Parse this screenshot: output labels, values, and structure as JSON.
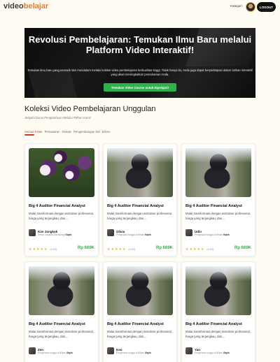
{
  "header": {
    "logo_part1": "video",
    "logo_part2": "belajar",
    "kategori": "Kategori",
    "logout": "LOGOUT"
  },
  "hero": {
    "title": "Revolusi Pembelajaran: Temukan Ilmu Baru melalui Platform Video Interaktif!",
    "subtitle": "Temukan ilmu baru yang menarik dan mendalam melalui koleksi video pembelajaran berkualitas tinggi. Tidak hanya itu, Anda juga dapat berpartisipasi dalam latihan interaktif yang akan meningkatkan pemahaman Anda.",
    "cta": "Temukan Video Course untuk Dipelajari!"
  },
  "section": {
    "title": "Koleksi Video Pembelajaran Unggulan",
    "subtitle": "Jelajahi Dunia Pengetahuan Melalui Pilihan Kami!",
    "filters": [
      "Semua Kelas",
      "Pemasaran",
      "Desain",
      "Pengembangan Diri",
      "Bisnis"
    ]
  },
  "cards": [
    {
      "title": "Big 4 Auditor Financial Analyst",
      "desc": "Mulai transformasi dengan instruktur profesional, harga yang terjangkau, dan...",
      "author": "Kim Jongkok",
      "role": "Senior Jongkok Ahli bidang",
      "role_company": "Gojek",
      "rating": "(4.5/5)",
      "price": "Rp 669K"
    },
    {
      "title": "Big 4 Auditor Financial Analyst",
      "desc": "Mulai transformasi dengan instruktur profesional, harga yang terjangkau, dan...",
      "author": "Olivia",
      "role": "Pengusaha tunggu di Bukan",
      "role_company": "Gojek",
      "rating": "(4.5/5)",
      "price": "Rp 669K"
    },
    {
      "title": "Big 4 Auditor Financial Analyst",
      "desc": "Mulai transformasi dengan instruktur profesional, harga yang terjangkau, dan...",
      "author": "Udin",
      "role": "Pengusaha tunggu di Bukan",
      "role_company": "Gojek",
      "rating": "(4.5/5)",
      "price": "Rp 669K"
    },
    {
      "title": "Big 4 Auditor Financial Analyst",
      "desc": "Mulai transformasi dengan instruktur profesional, harga yang terjangkau, dan...",
      "author": "Zen",
      "role": "Pengusaha tunggu di Bukan",
      "role_company": "Gojek",
      "rating": "",
      "price": ""
    },
    {
      "title": "Big 4 Auditor Financial Analyst",
      "desc": "Mulai transformasi dengan instruktur profesional, harga yang terjangkau, dan...",
      "author": "Ken",
      "role": "Pengusaha tunggu di Bukan",
      "role_company": "Gojek",
      "rating": "",
      "price": ""
    },
    {
      "title": "Big 4 Auditor Financial Analyst",
      "desc": "Mulai transformasi dengan instruktur profesional, harga yang terjangkau, dan...",
      "author": "Yan",
      "role": "Pengusaha tunggu di Bukan",
      "role_company": "Gojek",
      "rating": "",
      "price": ""
    }
  ],
  "colors": {
    "accent": "#f07a2a",
    "cta": "#2bb34a",
    "price": "#2bb34a",
    "filter_active": "#d9352f",
    "stars": "#f3b51a"
  }
}
